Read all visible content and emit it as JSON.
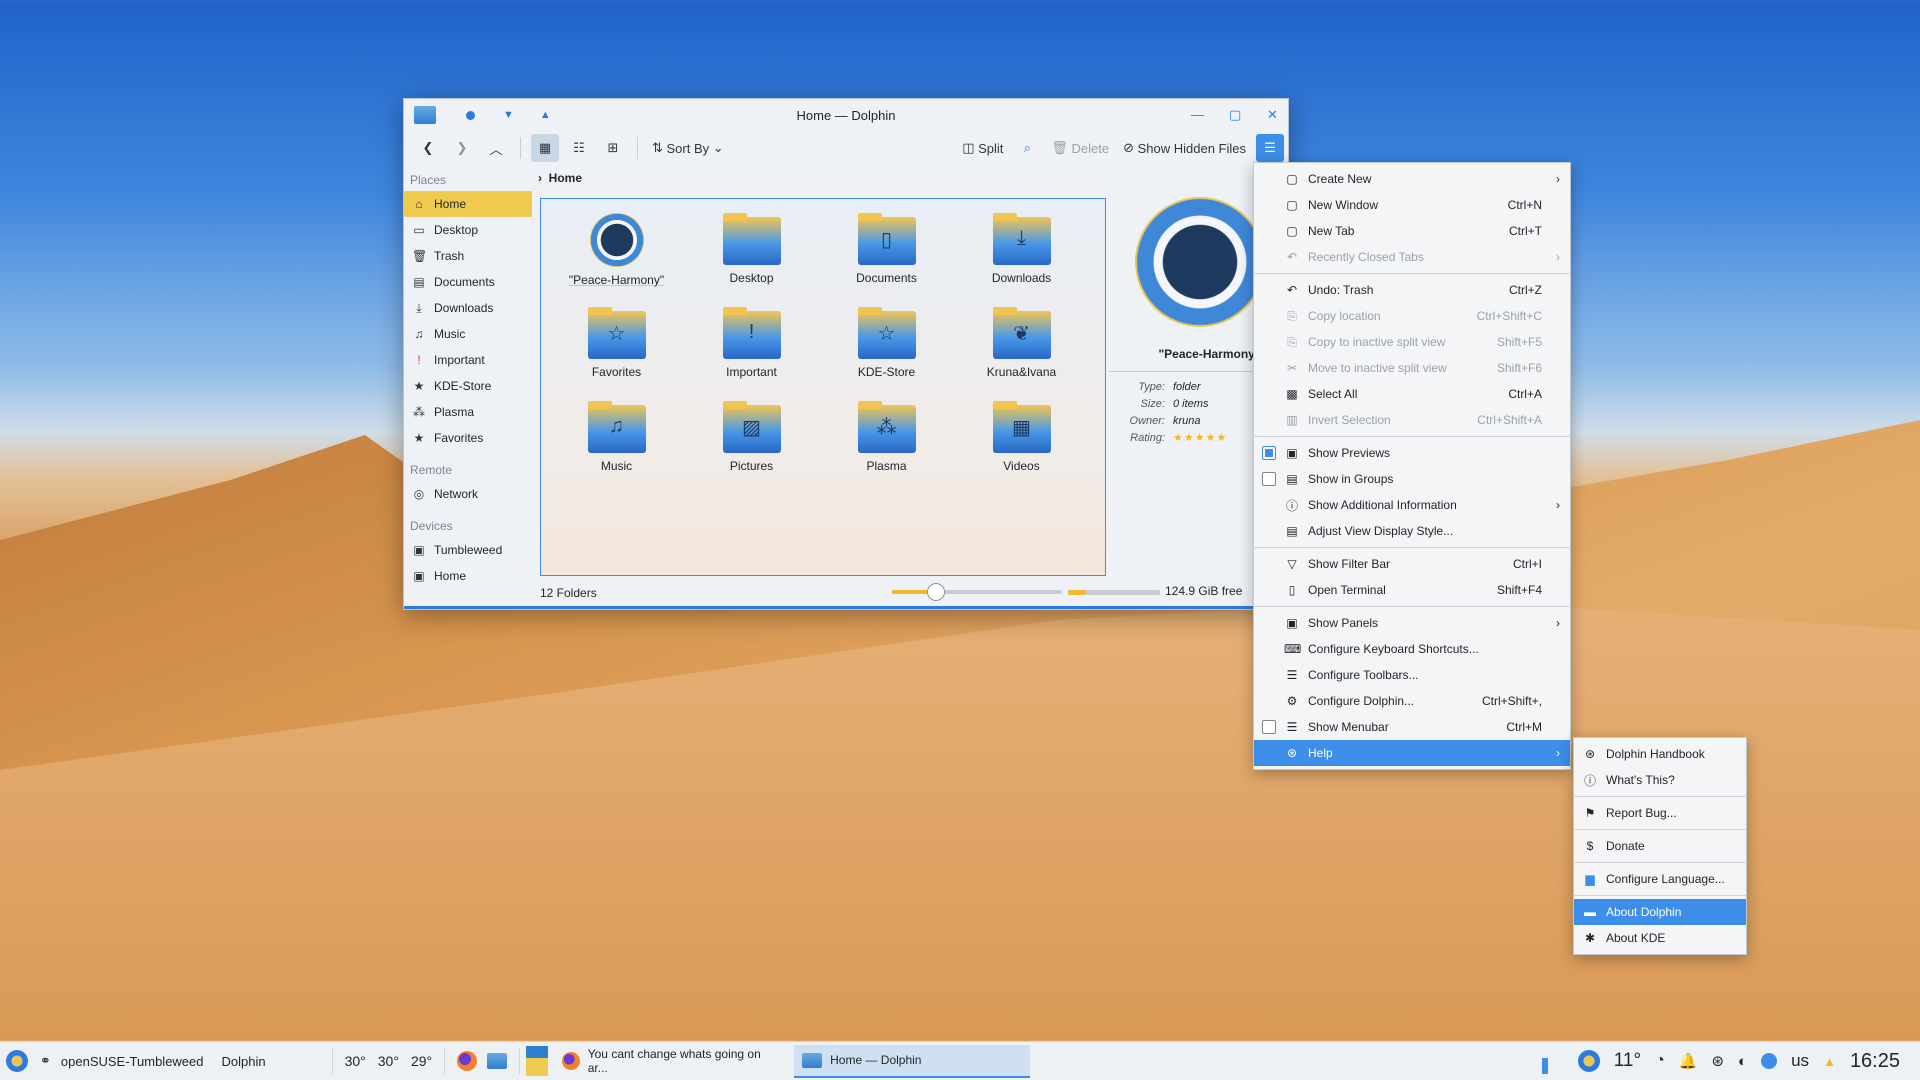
{
  "window": {
    "title": "Home — Dolphin",
    "toolbar": {
      "sort_by": "Sort By",
      "split": "Split",
      "delete": "Delete",
      "show_hidden": "Show Hidden Files"
    },
    "breadcrumb": "Home",
    "sidebar": {
      "places_header": "Places",
      "places": [
        {
          "label": "Home",
          "icon": "home-icon",
          "selected": true
        },
        {
          "label": "Desktop",
          "icon": "desktop-icon"
        },
        {
          "label": "Trash",
          "icon": "trash-icon"
        },
        {
          "label": "Documents",
          "icon": "documents-icon"
        },
        {
          "label": "Downloads",
          "icon": "downloads-icon"
        },
        {
          "label": "Music",
          "icon": "music-icon"
        },
        {
          "label": "Important",
          "icon": "important-icon"
        },
        {
          "label": "KDE-Store",
          "icon": "kde-store-icon"
        },
        {
          "label": "Plasma",
          "icon": "plasma-icon"
        },
        {
          "label": "Favorites",
          "icon": "favorites-icon"
        }
      ],
      "remote_header": "Remote",
      "remote": [
        {
          "label": "Network",
          "icon": "network-icon"
        }
      ],
      "devices_header": "Devices",
      "devices": [
        {
          "label": "Tumbleweed",
          "icon": "drive-icon"
        },
        {
          "label": "Home",
          "icon": "drive-icon"
        }
      ]
    },
    "files": [
      {
        "label": "\"Peace-Harmony\"",
        "icon": "yin-yang-icon"
      },
      {
        "label": "Desktop",
        "icon": "desktop-folder-icon"
      },
      {
        "label": "Documents",
        "icon": "documents-folder-icon"
      },
      {
        "label": "Downloads",
        "icon": "downloads-folder-icon"
      },
      {
        "label": "Favorites",
        "icon": "favorites-folder-icon"
      },
      {
        "label": "Important",
        "icon": "important-folder-icon"
      },
      {
        "label": "KDE-Store",
        "icon": "kde-store-folder-icon"
      },
      {
        "label": "Kruna&Ivana",
        "icon": "image-folder-icon"
      },
      {
        "label": "Music",
        "icon": "music-folder-icon"
      },
      {
        "label": "Pictures",
        "icon": "pictures-folder-icon"
      },
      {
        "label": "Plasma",
        "icon": "plasma-folder-icon"
      },
      {
        "label": "Videos",
        "icon": "videos-folder-icon"
      }
    ],
    "info_panel": {
      "name": "\"Peace-Harmony\"",
      "rows": [
        {
          "key": "Type:",
          "value": "folder"
        },
        {
          "key": "Size:",
          "value": "0 items"
        },
        {
          "key": "Owner:",
          "value": "kruna"
        },
        {
          "key": "Rating:",
          "value": "★★★★★"
        }
      ]
    },
    "status": {
      "count": "12 Folders",
      "free": "124.9 GiB free",
      "zoom_fraction": 0.26,
      "disk_used_fraction": 0.2
    }
  },
  "menu": [
    {
      "label": "Create New",
      "icon": "create-new-icon",
      "submenu": true
    },
    {
      "label": "New Window",
      "shortcut": "Ctrl+N",
      "icon": "new-window-icon"
    },
    {
      "label": "New Tab",
      "shortcut": "Ctrl+T",
      "icon": "new-tab-icon"
    },
    {
      "label": "Recently Closed Tabs",
      "icon": "undo-close-icon",
      "disabled": true,
      "submenu": true
    },
    {
      "sep": true
    },
    {
      "label": "Undo: Trash",
      "shortcut": "Ctrl+Z",
      "icon": "undo-icon"
    },
    {
      "label": "Copy location",
      "shortcut": "Ctrl+Shift+C",
      "icon": "copy-icon",
      "disabled": true
    },
    {
      "label": "Copy to inactive split view",
      "shortcut": "Shift+F5",
      "icon": "copy-split-icon",
      "disabled": true
    },
    {
      "label": "Move to inactive split view",
      "shortcut": "Shift+F6",
      "icon": "move-split-icon",
      "disabled": true
    },
    {
      "label": "Select All",
      "shortcut": "Ctrl+A",
      "icon": "select-all-icon"
    },
    {
      "label": "Invert Selection",
      "shortcut": "Ctrl+Shift+A",
      "icon": "invert-selection-icon",
      "disabled": true
    },
    {
      "sep": true
    },
    {
      "label": "Show Previews",
      "icon": "preview-icon",
      "check": true,
      "checked": true
    },
    {
      "label": "Show in Groups",
      "icon": "groups-icon",
      "check": true,
      "checked": false
    },
    {
      "label": "Show Additional Information",
      "icon": "info-icon",
      "submenu": true
    },
    {
      "label": "Adjust View Display Style...",
      "icon": "view-style-icon"
    },
    {
      "sep": true
    },
    {
      "label": "Show Filter Bar",
      "shortcut": "Ctrl+I",
      "icon": "filter-icon"
    },
    {
      "label": "Open Terminal",
      "shortcut": "Shift+F4",
      "icon": "terminal-icon"
    },
    {
      "sep": true
    },
    {
      "label": "Show Panels",
      "icon": "panels-icon",
      "submenu": true
    },
    {
      "label": "Configure Keyboard Shortcuts...",
      "icon": "keyboard-icon"
    },
    {
      "label": "Configure Toolbars...",
      "icon": "toolbars-icon"
    },
    {
      "label": "Configure Dolphin...",
      "shortcut": "Ctrl+Shift+,",
      "icon": "configure-icon"
    },
    {
      "label": "Show Menubar",
      "shortcut": "Ctrl+M",
      "icon": "menubar-icon",
      "check": true,
      "checked": false
    },
    {
      "label": "Help",
      "icon": "help-icon",
      "submenu": true,
      "highlighted": true
    }
  ],
  "help_menu": [
    {
      "label": "Dolphin Handbook",
      "icon": "handbook-icon"
    },
    {
      "label": "What's This?",
      "icon": "whats-this-icon"
    },
    {
      "sep": true
    },
    {
      "label": "Report Bug...",
      "icon": "bug-icon"
    },
    {
      "sep": true
    },
    {
      "label": "Donate",
      "icon": "donate-icon"
    },
    {
      "sep": true
    },
    {
      "label": "Configure Language...",
      "icon": "language-icon"
    },
    {
      "sep": true
    },
    {
      "label": "About Dolphin",
      "icon": "dolphin-icon",
      "highlighted": true
    },
    {
      "label": "About KDE",
      "icon": "kde-icon"
    }
  ],
  "taskbar": {
    "distro": "openSUSE-Tumbleweed",
    "app": "Dolphin",
    "temps": [
      "30°",
      "30°",
      "29°"
    ],
    "tasks": [
      {
        "label": "You cant change whats going on ar...",
        "icon": "firefox-icon"
      },
      {
        "label": "Home — Dolphin",
        "icon": "dolphin-icon",
        "active": true
      }
    ],
    "weather": "11°",
    "keyboard": "us",
    "clock": "16:25"
  },
  "colors": {
    "accent": "#3d8ee8",
    "selection": "#f0c94f"
  }
}
